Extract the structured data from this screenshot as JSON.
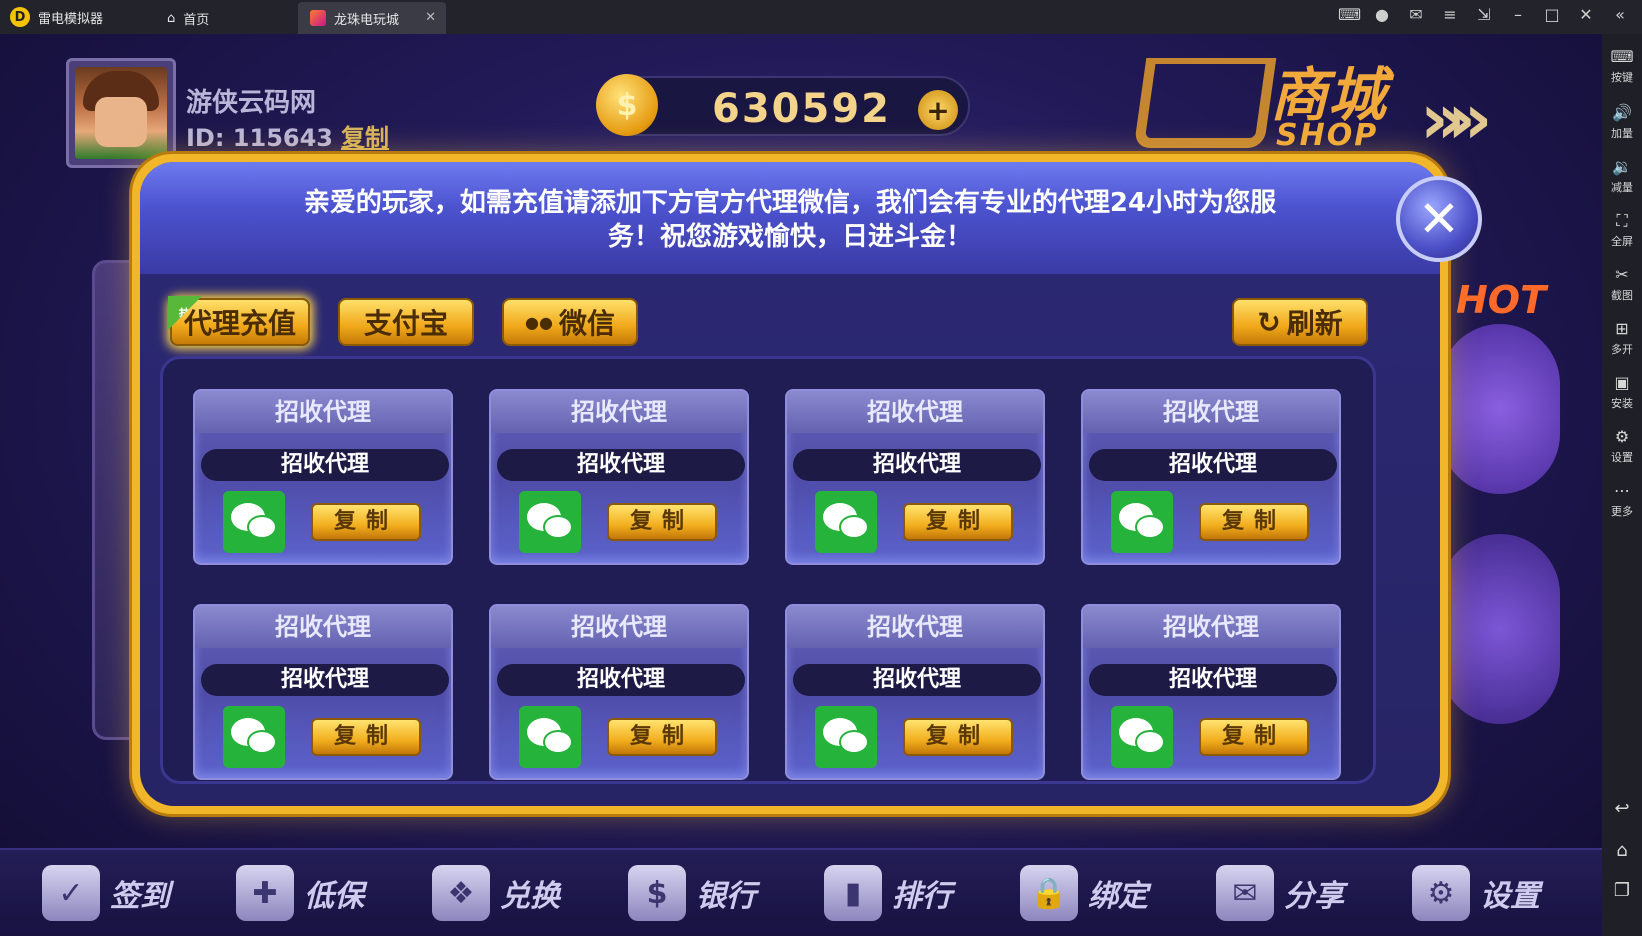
{
  "emulator": {
    "app_name": "雷电模拟器",
    "tabs": [
      {
        "label": "首页"
      },
      {
        "label": "龙珠电玩城"
      }
    ],
    "sidebar": [
      {
        "icon": "keyboard-icon",
        "glyph": "⌨",
        "label": "按键"
      },
      {
        "icon": "volume-up-icon",
        "glyph": "🔊",
        "label": "加量"
      },
      {
        "icon": "volume-down-icon",
        "glyph": "🔉",
        "label": "减量"
      },
      {
        "icon": "fullscreen-icon",
        "glyph": "⛶",
        "label": "全屏"
      },
      {
        "icon": "scissors-icon",
        "glyph": "✂",
        "label": "截图"
      },
      {
        "icon": "multi-open-icon",
        "glyph": "⊞",
        "label": "多开"
      },
      {
        "icon": "apk-icon",
        "glyph": "▣",
        "label": "安装"
      },
      {
        "icon": "gear-icon",
        "glyph": "⚙",
        "label": "设置"
      },
      {
        "icon": "more-icon",
        "glyph": "⋯",
        "label": "更多"
      }
    ]
  },
  "player": {
    "name": "游侠云码网",
    "id_text": "ID: 115643",
    "copy_label": "复制"
  },
  "coins": {
    "value": "630592",
    "coin_glyph": "$",
    "add_glyph": "+"
  },
  "shop": {
    "title": "商城",
    "subtitle": "SHOP",
    "arrows": "»»"
  },
  "side": {
    "hot_label": "HOT"
  },
  "modal": {
    "notice": "亲爱的玩家，如需充值请添加下方官方代理微信，我们会有专业的代理24小时为您服务！祝您游戏愉快，日进斗金！",
    "close_glyph": "✕",
    "tabs": {
      "agent": "代理充值",
      "agent_hot_tag": "热",
      "alipay": "支付宝",
      "wechat": "微信",
      "refresh": "刷新",
      "refresh_glyph": "↻",
      "wechat_glyph": "●●"
    },
    "cards": [
      {
        "title": "招收代理",
        "account": "招收代理",
        "copy": "复制"
      },
      {
        "title": "招收代理",
        "account": "招收代理",
        "copy": "复制"
      },
      {
        "title": "招收代理",
        "account": "招收代理",
        "copy": "复制"
      },
      {
        "title": "招收代理",
        "account": "招收代理",
        "copy": "复制"
      },
      {
        "title": "招收代理",
        "account": "招收代理",
        "copy": "复制"
      },
      {
        "title": "招收代理",
        "account": "招收代理",
        "copy": "复制"
      },
      {
        "title": "招收代理",
        "account": "招收代理",
        "copy": "复制"
      },
      {
        "title": "招收代理",
        "account": "招收代理",
        "copy": "复制"
      }
    ]
  },
  "bottom_nav": [
    {
      "icon": "calendar-check-icon",
      "glyph": "✓",
      "label": "签到"
    },
    {
      "icon": "gamepad-icon",
      "glyph": "✚",
      "label": "低保"
    },
    {
      "icon": "gift-icon",
      "glyph": "❖",
      "label": "兑换"
    },
    {
      "icon": "bank-card-icon",
      "glyph": "$",
      "label": "银行"
    },
    {
      "icon": "ranking-icon",
      "glyph": "▮",
      "label": "排行"
    },
    {
      "icon": "lock-icon",
      "glyph": "🔒",
      "label": "绑定"
    },
    {
      "icon": "chat-bubble-icon",
      "glyph": "✉",
      "label": "分享"
    },
    {
      "icon": "gear-icon",
      "glyph": "⚙",
      "label": "设置"
    }
  ],
  "colors": {
    "gold": "#f2b62a",
    "modal_bg": "#272465",
    "wechat_green": "#26b33c",
    "button_gold": "#f0a81a"
  }
}
